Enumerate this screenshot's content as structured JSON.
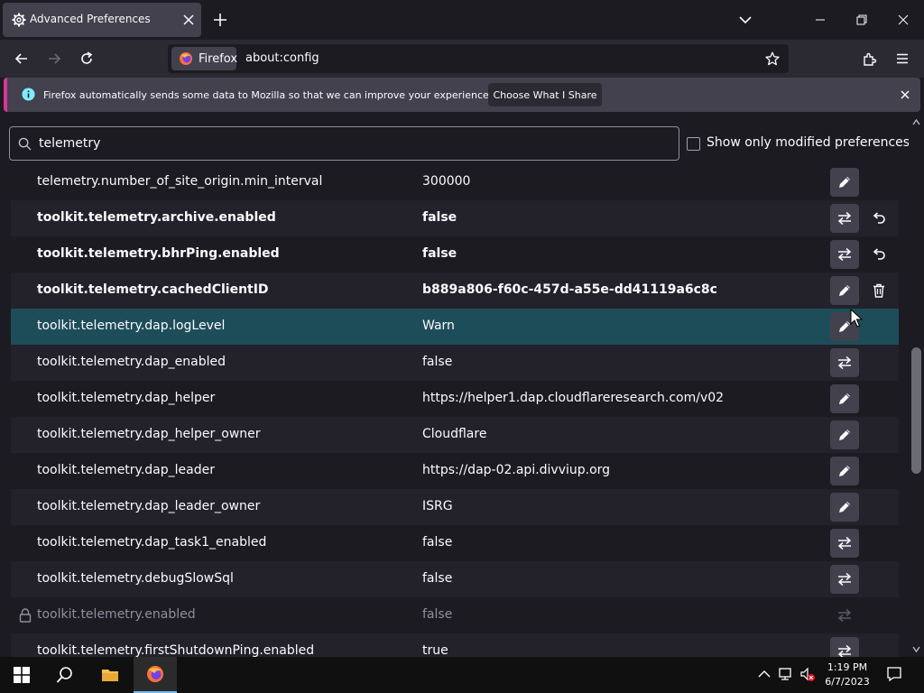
{
  "tab": {
    "title": "Advanced Preferences"
  },
  "urlbar": {
    "identity_label": "Firefox",
    "url": "about:config"
  },
  "notification": {
    "message": "Firefox automatically sends some data to Mozilla so that we can improve your experience.",
    "button_label": "Choose What I Share"
  },
  "search": {
    "value": "telemetry"
  },
  "filter": {
    "label": "Show only modified preferences",
    "checked": false
  },
  "prefs": [
    {
      "name": "telemetry.number_of_site_origin.min_interval",
      "value": "300000",
      "action": "edit-icon",
      "extra": "",
      "modified": false,
      "locked": false
    },
    {
      "name": "toolkit.telemetry.archive.enabled",
      "value": "false",
      "action": "toggle-icon",
      "extra": "reset-icon",
      "modified": true,
      "locked": false
    },
    {
      "name": "toolkit.telemetry.bhrPing.enabled",
      "value": "false",
      "action": "toggle-icon",
      "extra": "reset-icon",
      "modified": true,
      "locked": false
    },
    {
      "name": "toolkit.telemetry.cachedClientID",
      "value": "b889a806-f60c-457d-a55e-dd41119a6c8c",
      "action": "edit-icon",
      "extra": "delete-icon",
      "modified": true,
      "locked": false
    },
    {
      "name": "toolkit.telemetry.dap.logLevel",
      "value": "Warn",
      "action": "edit-icon",
      "extra": "",
      "modified": false,
      "locked": false,
      "highlighted": true
    },
    {
      "name": "toolkit.telemetry.dap_enabled",
      "value": "false",
      "action": "toggle-icon",
      "extra": "",
      "modified": false,
      "locked": false
    },
    {
      "name": "toolkit.telemetry.dap_helper",
      "value": "https://helper1.dap.cloudflareresearch.com/v02",
      "action": "edit-icon",
      "extra": "",
      "modified": false,
      "locked": false
    },
    {
      "name": "toolkit.telemetry.dap_helper_owner",
      "value": "Cloudflare",
      "action": "edit-icon",
      "extra": "",
      "modified": false,
      "locked": false
    },
    {
      "name": "toolkit.telemetry.dap_leader",
      "value": "https://dap-02.api.divviup.org",
      "action": "edit-icon",
      "extra": "",
      "modified": false,
      "locked": false
    },
    {
      "name": "toolkit.telemetry.dap_leader_owner",
      "value": "ISRG",
      "action": "edit-icon",
      "extra": "",
      "modified": false,
      "locked": false
    },
    {
      "name": "toolkit.telemetry.dap_task1_enabled",
      "value": "false",
      "action": "toggle-icon",
      "extra": "",
      "modified": false,
      "locked": false
    },
    {
      "name": "toolkit.telemetry.debugSlowSql",
      "value": "false",
      "action": "toggle-icon",
      "extra": "",
      "modified": false,
      "locked": false
    },
    {
      "name": "toolkit.telemetry.enabled",
      "value": "false",
      "action": "toggle-icon",
      "extra": "",
      "modified": false,
      "locked": true
    },
    {
      "name": "toolkit.telemetry.firstShutdownPing.enabled",
      "value": "true",
      "action": "toggle-icon",
      "extra": "",
      "modified": false,
      "locked": false
    }
  ],
  "taskbar": {
    "time": "1:19 PM",
    "date": "6/7/2023"
  },
  "colors": {
    "accent_teal": "#1e4d5a",
    "notice_stripe": "#d83694",
    "button_bg": "#42414d"
  }
}
